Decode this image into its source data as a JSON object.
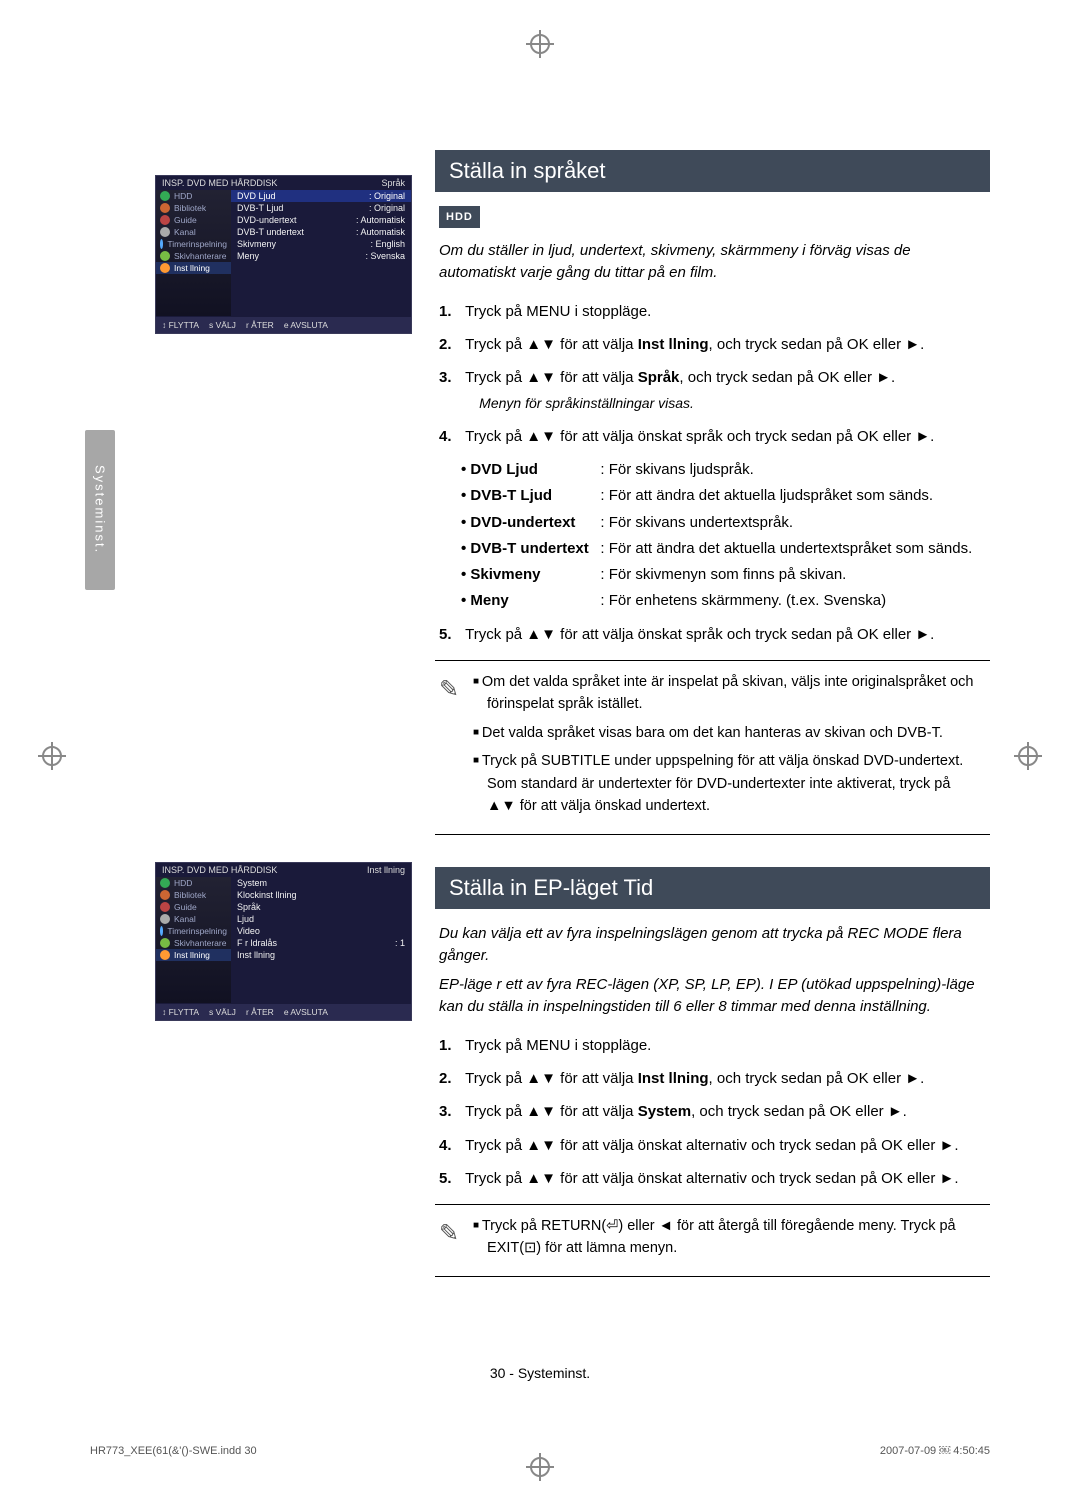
{
  "sideTab": "Systeminst.",
  "cropGlyph": "⊕",
  "section1": {
    "title": "Ställa in språket",
    "badge": "HDD",
    "intro": "Om du ställer in ljud, undertext, skivmeny, skärmmeny i förväg visas de automatiskt varje gång du tittar på en film.",
    "titlebar_left": "INSP. DVD MED HÅRDDISK",
    "titlebar_right": "Språk",
    "sidebar": [
      {
        "label": "HDD"
      },
      {
        "label": "Bibliotek"
      },
      {
        "label": "Guide"
      },
      {
        "label": "Kanal"
      },
      {
        "label": "Timerinspelning"
      },
      {
        "label": "Skivhanterare"
      },
      {
        "label": "Inst llning"
      }
    ],
    "rows": [
      {
        "k": "DVD Ljud",
        "v": ": Original",
        "sel": true
      },
      {
        "k": "DVB-T Ljud",
        "v": ": Original"
      },
      {
        "k": "DVD-undertext",
        "v": ": Automatisk"
      },
      {
        "k": "DVB-T undertext",
        "v": ": Automatisk"
      },
      {
        "k": "Skivmeny",
        "v": ": English"
      },
      {
        "k": "Meny",
        "v": ": Svenska"
      }
    ],
    "footer": [
      "↕ FLYTTA",
      "s VÄLJ",
      "r ÅTER",
      "e AVSLUTA"
    ],
    "steps": {
      "s1": "Tryck på MENU i stoppläge.",
      "s2": [
        "Tryck på ▲▼ för att välja ",
        "Inst llning",
        ", och tryck sedan på OK eller ►."
      ],
      "s3_a": [
        "Tryck på ▲▼ för att välja ",
        "Språk",
        ", och tryck sedan på OK eller ►."
      ],
      "s3_b": "Menyn för språkinställningar visas.",
      "s4": [
        "Tryck på ▲▼ för att välja önskat språk och tryck sedan på OK eller ►."
      ],
      "s5": [
        "Tryck på ▲▼ för att välja önskat språk och tryck sedan på OK eller ►."
      ]
    },
    "bullets": [
      {
        "k": "DVD Ljud",
        "v": ": För skivans ljudspråk."
      },
      {
        "k": "DVB-T Ljud",
        "v": ": För att ändra det aktuella ljudspråket som sänds."
      },
      {
        "k": "DVD-undertext",
        "v": ": För skivans undertextspråk."
      },
      {
        "k": "DVB-T undertext",
        "v": ": För att ändra det aktuella undertextspråket som sänds."
      },
      {
        "k": "Skivmeny",
        "v": ": För skivmenyn som finns på skivan."
      },
      {
        "k": "Meny",
        "v": ": För enhetens skärmmeny. (t.ex. Svenska)"
      }
    ],
    "notes": [
      "Om det valda språket inte är inspelat på skivan, väljs inte originalspråket och förinspelat språk istället.",
      "Det valda språket visas bara om det kan hanteras av skivan och DVB-T.",
      "Tryck på SUBTITLE under uppspelning för att välja önskad DVD-undertext. Som standard är undertexter för DVD-undertexter inte aktiverat, tryck på ▲▼ för att välja önskad undertext."
    ]
  },
  "section2": {
    "title": "Ställa in EP-läget Tid",
    "titlebar_left": "INSP. DVD MED HÅRDDISK",
    "titlebar_right": "Inst llning",
    "rows": [
      {
        "k": "System",
        "v": ""
      },
      {
        "k": "Klockinst llning",
        "v": ""
      },
      {
        "k": "Språk",
        "v": ""
      },
      {
        "k": "Ljud",
        "v": ""
      },
      {
        "k": "Video",
        "v": ""
      },
      {
        "k": "F r ldralås",
        "v": ": 1"
      },
      {
        "k": "Inst llning",
        "v": ""
      }
    ],
    "footer": [
      "↕ FLYTTA",
      "s VÄLJ",
      "r ÅTER",
      "e AVSLUTA"
    ],
    "intro1": "Du kan välja ett av fyra inspelningslägen genom att trycka på REC MODE flera gånger.",
    "intro2": "EP-läge r ett av fyra REC-lägen (XP, SP, LP, EP). I EP (utökad uppspelning)-läge kan du ställa in inspelningstiden till 6 eller 8 timmar med denna inställning.",
    "steps": {
      "s1": "Tryck på MENU i stoppläge.",
      "s2": [
        "Tryck på ▲▼ för att välja ",
        "Inst llning",
        ", och tryck sedan på OK eller ►."
      ],
      "s3": [
        "Tryck på ▲▼ för att välja ",
        "System",
        ", och tryck sedan på OK eller ►."
      ],
      "s4": [
        "Tryck på ▲▼ för att välja önskat alternativ och tryck sedan på OK eller ►."
      ],
      "s5": [
        "Tryck på ▲▼ för att välja önskat alternativ och tryck sedan på OK eller ►."
      ]
    },
    "notes": [
      "Tryck på RETURN(⏎) eller ◄ för att återgå till föregående meny. Tryck på EXIT(⊡) för att lämna menyn."
    ]
  },
  "pageNum": "30 - Systeminst.",
  "footer_left": "HR773_XEE(61(&'()-SWE.indd   30",
  "footer_right": "2007-07-09   ￼ 4:50:45"
}
